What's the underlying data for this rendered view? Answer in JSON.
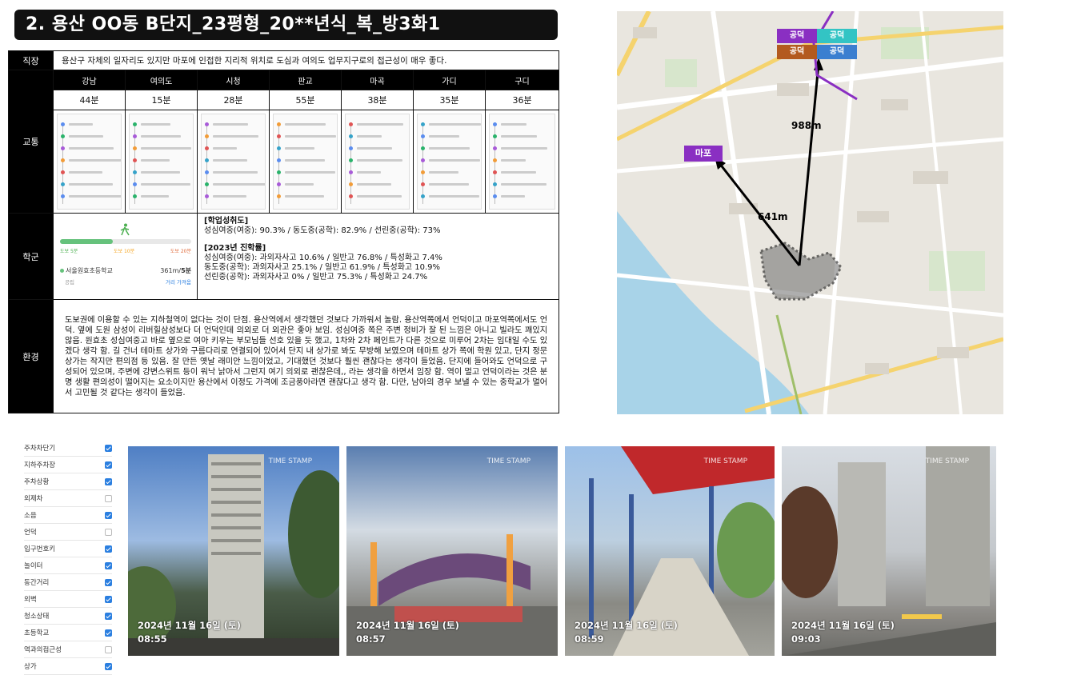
{
  "title": "2. 용산 OO동 B단지_23평형_20**년식_복_방3화1",
  "job": {
    "label": "직장",
    "text": "용산구 자체의 일자리도 있지만 마포에 인접한 지리적 위치로 도심과 여의도 업무지구로의 접근성이 매우 좋다."
  },
  "traffic": {
    "label": "교통",
    "destinations": [
      {
        "name": "강남",
        "time": "44분"
      },
      {
        "name": "여의도",
        "time": "15분"
      },
      {
        "name": "시청",
        "time": "28분"
      },
      {
        "name": "판교",
        "time": "55분"
      },
      {
        "name": "마곡",
        "time": "38분"
      },
      {
        "name": "가디",
        "time": "35분"
      },
      {
        "name": "구디",
        "time": "36분"
      }
    ]
  },
  "school": {
    "label": "학군",
    "walk_labels": [
      "도보 5분",
      "도보 10분",
      "도보 20분"
    ],
    "school_name": "서울원효초등학교",
    "school_type": "공립",
    "distance": "361m/",
    "minutes": "5분",
    "route_link": "거리 가져옴",
    "achievement_title": "[학업성취도]",
    "achievement_text": "성심여중(여중): 90.3% / 동도중(공학): 82.9% / 선린중(공학): 73%",
    "advancement_title": "[2023년 진학률]",
    "advancement_lines": [
      "성심여중(여중):  과외자사고 10.6% / 일반고 76.8% / 특성화고 7.4%",
      "동도중(공학): 과외자사고 25.1% / 일반고 61.9% / 특성화고 10.9%",
      "선린중(공학): 과외자사고 0% / 일반고 75.3% / 특성화고 24.7%"
    ]
  },
  "environment": {
    "label": "환경",
    "text": "도보권에 이용할 수 있는 지하철역이 없다는 것이 단점. 용산역에서 생각했던 것보다 가까워서 놀람. 용산역쪽에서 언덕이고 마포역쪽에서도 언덕. 옆에 도원 삼성이 리버힐삼성보다 더 언덕인데 의외로 더 외관은 좋아 보임. 성심여중 쪽은 주변 정비가 잘 된 느낌은 아니고 빌라도 꽤있지 않음. 원효초 성심여중고 바로 옆으로 여아 키우는 부모님들 선호 있을 듯 했고, 1차와 2차 페인트가 다른 것으로 미루어 2차는 임대일 수도 있겠다 생각 함. 길 건너 테마트 상가와 구름다리로 연결되어 있어서 단지 내 상가로 봐도 무방해 보였으며 테마트 상가 쪽에 학원 있고, 단지 정문 상가는 작지만 편의점 등 있음. 잘 만든 옛날 래미안 느낌이었고, 기대했던 것보다 훨씬 괜찮다는 생각이 들었음. 단지에 들어와도 언덕으로 구성되어 있으며, 주변에 강변스위트 등이 워낙 낡아서 그런지 여기 의외로 괜찮은데,, 라는 생각을 하면서 임장 함. 역이 멀고 언덕이라는 것은 분명 생활 편의성이 떨어지는 요소이지만 용산에서 이정도 가격에 조금풍아라면 괜찮다고 생각 함. 다만, 남아의 경우 보낼 수 있는 중학교가 멀어서 고민될 것 같다는 생각이 들었음."
  },
  "map": {
    "labels": {
      "gongdeok_purple": "공덕",
      "gongdeok_teal": "공덕",
      "gongdeok_brown": "공덕",
      "gongdeok_blue": "공덕",
      "mapo": "마포",
      "dist_gongdeok": "988m",
      "dist_mapo": "641m"
    },
    "colors": {
      "purple": "#8a2fc2",
      "teal": "#33c4c4",
      "brown": "#b35a1f",
      "blue": "#3b7fd0"
    }
  },
  "checklist": [
    {
      "label": "주차차단기",
      "checked": true
    },
    {
      "label": "지하주차장",
      "checked": true
    },
    {
      "label": "주차상황",
      "checked": true
    },
    {
      "label": "외제차",
      "checked": false
    },
    {
      "label": "소음",
      "checked": true
    },
    {
      "label": "언덕",
      "checked": false
    },
    {
      "label": "입구번호키",
      "checked": true
    },
    {
      "label": "놀이터",
      "checked": true
    },
    {
      "label": "동간거리",
      "checked": true
    },
    {
      "label": "외벽",
      "checked": true
    },
    {
      "label": "청소상태",
      "checked": true
    },
    {
      "label": "초등학교",
      "checked": true
    },
    {
      "label": "역과의접근성",
      "checked": false
    },
    {
      "label": "상가",
      "checked": true
    }
  ],
  "photos": [
    {
      "stamp": "TIME STAMP",
      "date": "2024년 11월 16일 (토)",
      "time": "08:55"
    },
    {
      "stamp": "TIME STAMP",
      "date": "2024년 11월 16일 (토)",
      "time": "08:57"
    },
    {
      "stamp": "TIME STAMP",
      "date": "2024년 11월 16일 (토)",
      "time": "08:59"
    },
    {
      "stamp": "TIME STAMP",
      "date": "2024년 11월 16일 (토)",
      "time": "09:03"
    }
  ]
}
